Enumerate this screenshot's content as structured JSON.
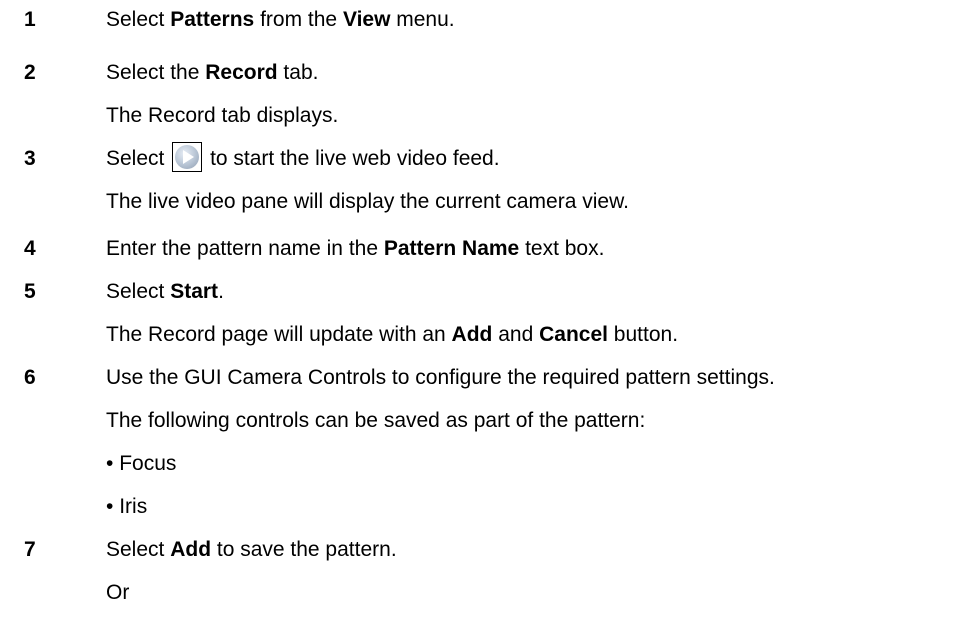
{
  "steps": [
    {
      "num": "1",
      "parts": [
        "Select ",
        "Patterns",
        " from the ",
        "View",
        " menu."
      ]
    },
    {
      "num": "2",
      "parts": [
        "Select the ",
        "Record",
        " tab."
      ],
      "note": "The Record tab displays."
    },
    {
      "num": "3",
      "before": "Select",
      "icon": "play-icon",
      "after": "to start the live web video feed.",
      "note": "The live video pane will display the current camera view."
    },
    {
      "num": "4",
      "parts": [
        "Enter the pattern name in the ",
        "Pattern Name",
        " text box."
      ]
    },
    {
      "num": "5",
      "parts": [
        "Select ",
        "Start",
        "."
      ],
      "note_parts": [
        "The Record page will update with an ",
        "Add",
        " and ",
        "Cancel",
        " button."
      ]
    },
    {
      "num": "6",
      "text": "Use the GUI Camera Controls to configure the required pattern settings.",
      "note": "The following controls can be saved as part of the pattern:",
      "bullets": [
        "Focus",
        "Iris"
      ]
    },
    {
      "num": "7",
      "parts": [
        "Select ",
        "Add",
        " to save the pattern."
      ],
      "note": "Or"
    }
  ],
  "bullet_char": "•"
}
